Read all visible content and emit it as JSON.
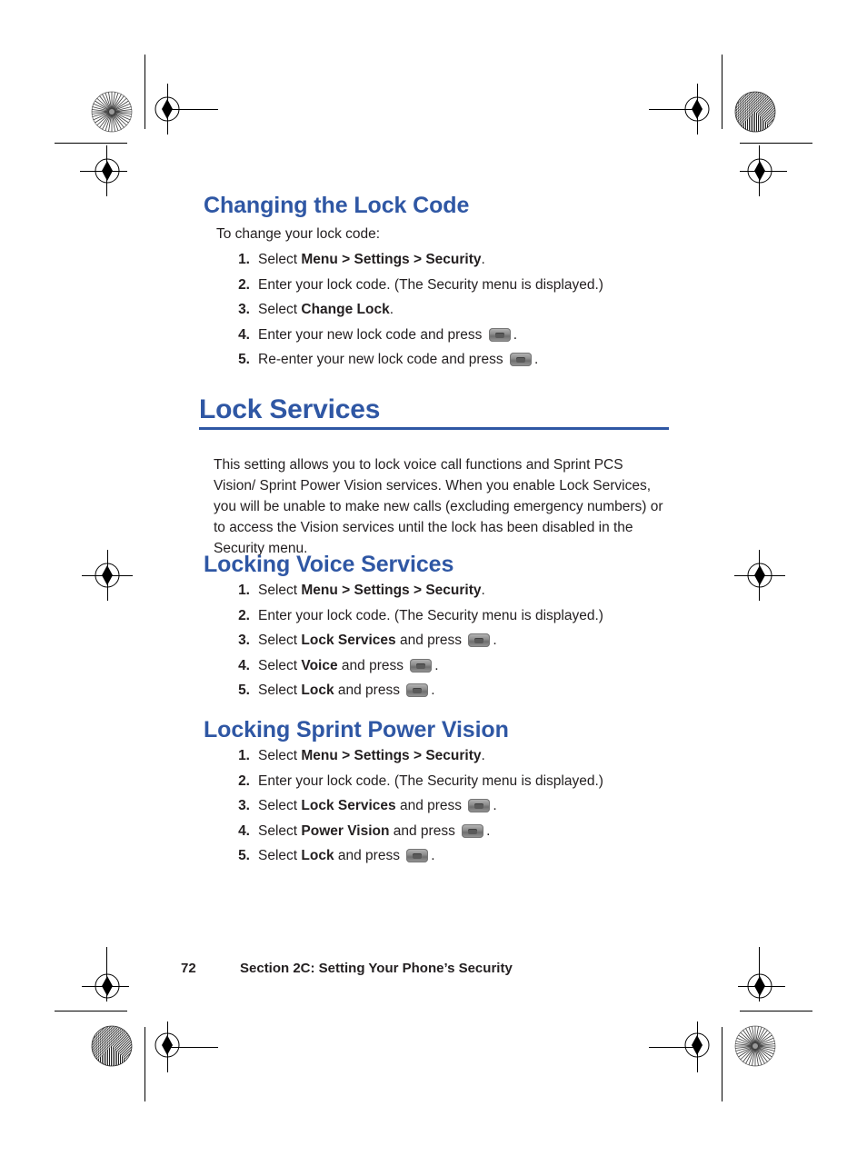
{
  "page": {
    "number": "72",
    "section_title": "Section 2C: Setting Your Phone’s Security",
    "accent_color": "#2f57a4",
    "text_color": "#231f20"
  },
  "sections": [
    {
      "id": "changing-the-lock-code",
      "level": "h2",
      "heading": "Changing the Lock Code",
      "intro": "To change your lock code:",
      "steps": [
        {
          "num": "1.",
          "pre": "Select ",
          "bold": "Menu > Settings > Security",
          "post": ".",
          "icon": false,
          "tail": ""
        },
        {
          "num": "2.",
          "pre": "Enter your lock code. (The Security menu is displayed.)",
          "bold": "",
          "post": "",
          "icon": false,
          "tail": ""
        },
        {
          "num": "3.",
          "pre": "Select ",
          "bold": "Change Lock",
          "post": ".",
          "icon": false,
          "tail": ""
        },
        {
          "num": "4.",
          "pre": "Enter your new lock code and press ",
          "bold": "",
          "post": "",
          "icon": true,
          "tail": "."
        },
        {
          "num": "5.",
          "pre": "Re-enter your new lock code and press ",
          "bold": "",
          "post": "",
          "icon": true,
          "tail": "."
        }
      ]
    },
    {
      "id": "lock-services",
      "level": "h1",
      "heading": "Lock Services",
      "paragraph": "This setting allows you to lock voice call functions and Sprint PCS Vision/ Sprint Power Vision services. When you enable Lock Services, you will be unable to make new calls (excluding emergency numbers) or to access the Vision services until the lock has been disabled in the Security menu."
    },
    {
      "id": "locking-voice-services",
      "level": "h2",
      "heading": "Locking Voice Services",
      "steps": [
        {
          "num": "1.",
          "pre": "Select ",
          "bold": "Menu > Settings > Security",
          "post": ".",
          "icon": false,
          "tail": ""
        },
        {
          "num": "2.",
          "pre": "Enter your lock code. (The Security menu is displayed.)",
          "bold": "",
          "post": "",
          "icon": false,
          "tail": ""
        },
        {
          "num": "3.",
          "pre": "Select ",
          "bold": "Lock Services",
          "post": " and press ",
          "icon": true,
          "tail": "."
        },
        {
          "num": "4.",
          "pre": "Select ",
          "bold": "Voice",
          "post": " and press ",
          "icon": true,
          "tail": "."
        },
        {
          "num": "5.",
          "pre": "Select ",
          "bold": "Lock",
          "post": " and press ",
          "icon": true,
          "tail": "."
        }
      ]
    },
    {
      "id": "locking-sprint-power-vision",
      "level": "h2",
      "heading": "Locking Sprint Power Vision",
      "steps": [
        {
          "num": "1.",
          "pre": "Select ",
          "bold": "Menu > Settings > Security",
          "post": ".",
          "icon": false,
          "tail": ""
        },
        {
          "num": "2.",
          "pre": "Enter your lock code. (The Security menu is displayed.)",
          "bold": "",
          "post": "",
          "icon": false,
          "tail": ""
        },
        {
          "num": "3.",
          "pre": "Select ",
          "bold": "Lock Services",
          "post": " and press ",
          "icon": true,
          "tail": "."
        },
        {
          "num": "4.",
          "pre": "Select ",
          "bold": "Power Vision",
          "post": " and press ",
          "icon": true,
          "tail": "."
        },
        {
          "num": "5.",
          "pre": "Select ",
          "bold": "Lock",
          "post": " and press ",
          "icon": true,
          "tail": "."
        }
      ]
    }
  ],
  "icons": {
    "select_key": "phone-ok-key-icon"
  }
}
